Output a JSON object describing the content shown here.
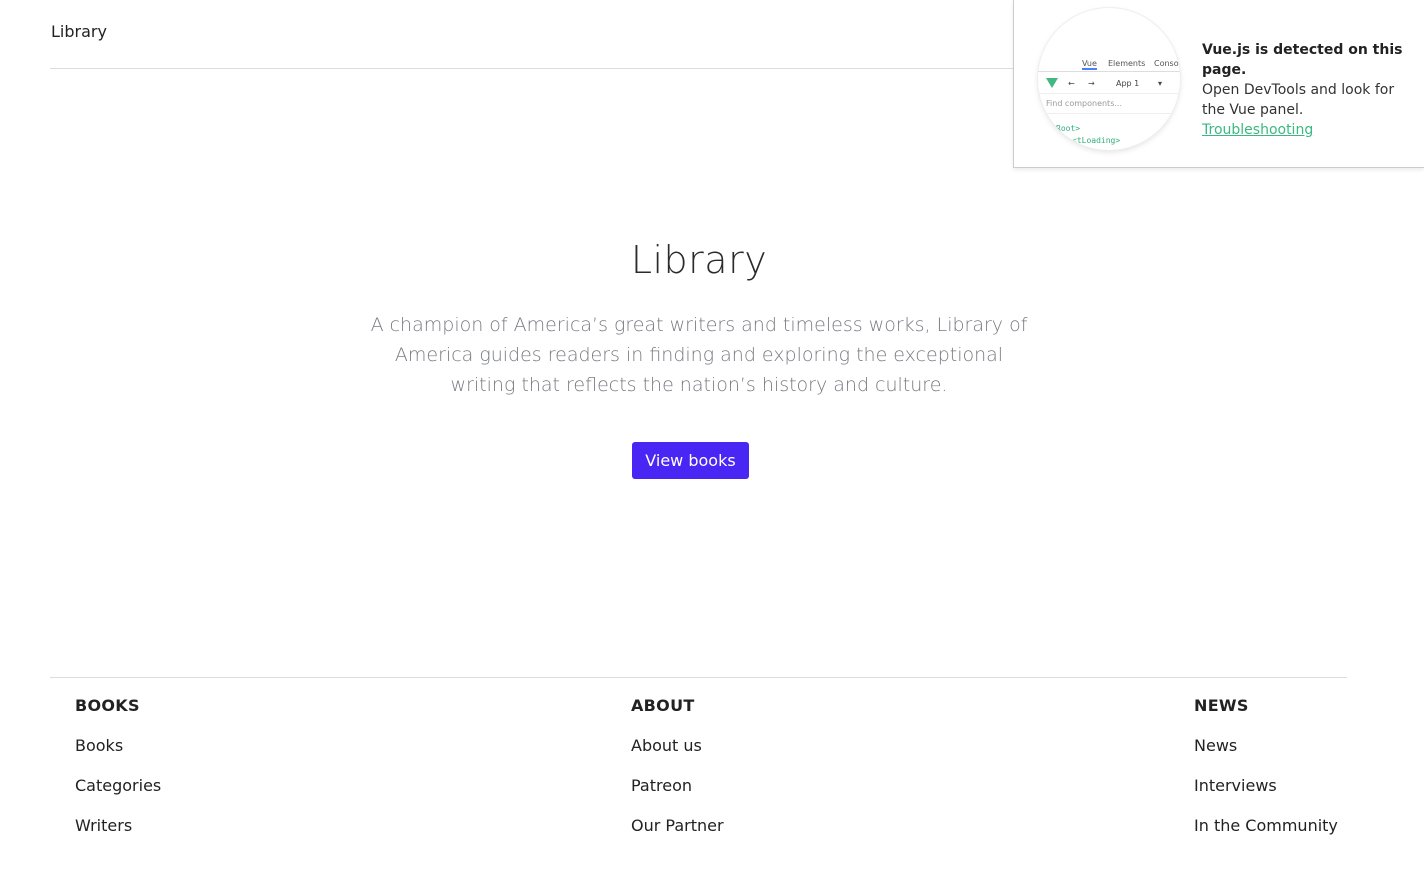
{
  "header": {
    "brand": "Library"
  },
  "hero": {
    "title": "Library",
    "description": "A champion of America’s great writers and timeless works, Library of America guides readers in finding and exploring the exceptional writing that reflects the nation’s history and culture.",
    "cta_label": "View books",
    "cta_color": "#4a26f5"
  },
  "footer": {
    "columns": [
      {
        "title": "BOOKS",
        "links": [
          "Books",
          "Categories",
          "Writers"
        ]
      },
      {
        "title": "ABOUT",
        "links": [
          "About us",
          "Patreon",
          "Our Partner"
        ]
      },
      {
        "title": "NEWS",
        "links": [
          "News",
          "Interviews",
          "In the Community"
        ]
      }
    ]
  },
  "vue_popup": {
    "heading": "Vue.js is detected on this page.",
    "body": "Open DevTools and look for the Vue panel.",
    "link": "Troubleshooting",
    "preview": {
      "tabs": [
        "Vue",
        "Elements",
        "Conso"
      ],
      "app_label": "App 1",
      "find_placeholder": "Find components...",
      "code_lines": [
        "Root>",
        "<tLoading>"
      ]
    },
    "link_color": "#3bb882"
  }
}
